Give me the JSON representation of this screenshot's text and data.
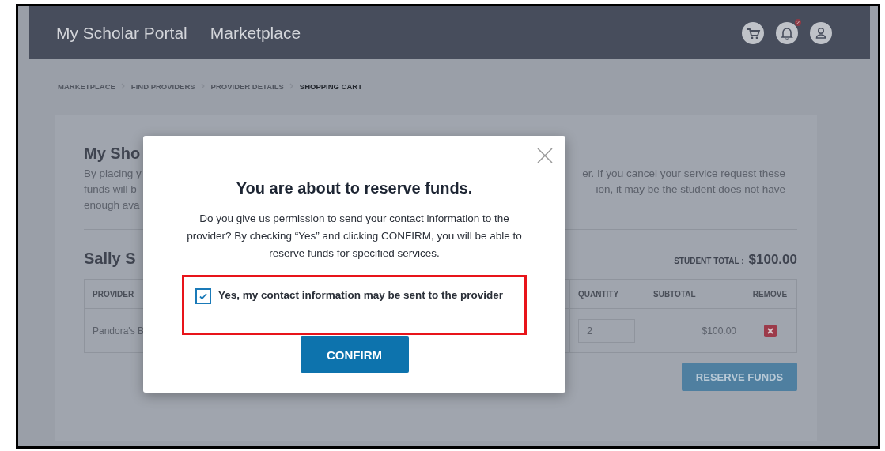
{
  "header": {
    "brand": "My Scholar Portal",
    "section": "Marketplace",
    "notification_count": "2"
  },
  "breadcrumbs": [
    {
      "label": "MARKETPLACE",
      "current": false
    },
    {
      "label": "FIND PROVIDERS",
      "current": false
    },
    {
      "label": "PROVIDER DETAILS",
      "current": false
    },
    {
      "label": "SHOPPING CART",
      "current": true
    }
  ],
  "cart": {
    "title": "My Sho",
    "intro_lines": [
      {
        "left": "By placing y",
        "right": "er. If you cancel your service request these"
      },
      {
        "left": "funds will b",
        "right": "ion, it may be the student does not have"
      },
      {
        "left": "enough ava"
      }
    ],
    "student": {
      "name": "Sally S",
      "total_label": "STUDENT TOTAL :",
      "total": "$100.00"
    },
    "table": {
      "columns": [
        "PROVIDER",
        "QUANTITY",
        "SUBTOTAL",
        "REMOVE"
      ],
      "rows": [
        {
          "provider": "Pandora's B",
          "quantity": "2",
          "subtotal": "$100.00"
        }
      ]
    },
    "reserve_button": "RESERVE FUNDS"
  },
  "modal": {
    "title": "You are about to reserve funds.",
    "message": "Do you give us permission to send your contact information to the provider? By checking “Yes” and clicking CONFIRM, you will be able to reserve funds for specified services.",
    "consent": {
      "label": "Yes, my contact information may be sent to the provider",
      "checked": true,
      "highlighted": true
    },
    "confirm_button": "CONFIRM"
  }
}
